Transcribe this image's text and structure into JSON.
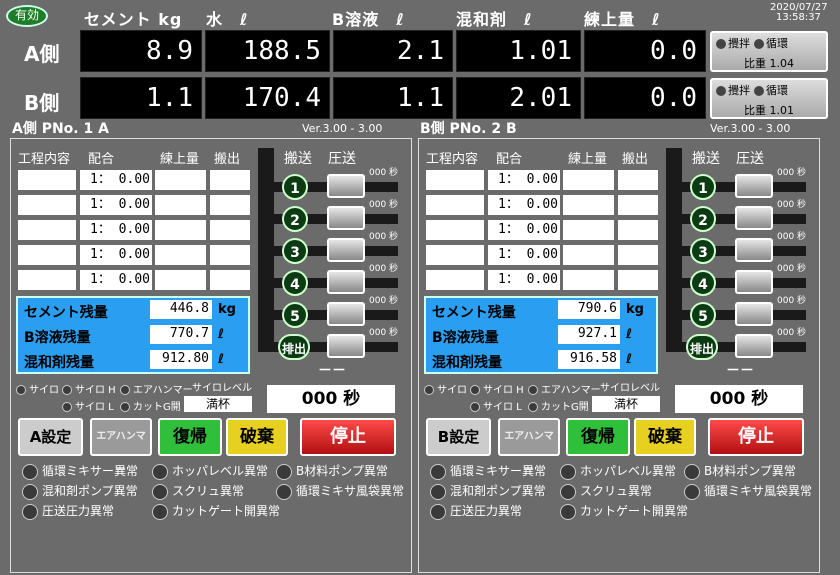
{
  "status_badge": "有効",
  "datetime": {
    "date": "2020/07/27",
    "time": "13:58:37"
  },
  "columns": {
    "cement": "セメント kg",
    "water": "水　ℓ",
    "bsol": "B溶液　ℓ",
    "mix": "混和剤　ℓ",
    "total": "練上量　ℓ"
  },
  "rows": [
    {
      "label": "A側",
      "cement": "8.9",
      "water": "188.5",
      "bsol": "2.1",
      "mix": "1.01",
      "total": "0.0",
      "stir": "攪拌",
      "cycle": "循環",
      "sg": "比重 1.04"
    },
    {
      "label": "B側",
      "cement": "1.1",
      "water": "170.4",
      "bsol": "1.1",
      "mix": "2.01",
      "total": "0.0",
      "stir": "攪拌",
      "cycle": "循環",
      "sg": "比重 1.01"
    }
  ],
  "panels": [
    {
      "title": "A側 PNo. 1 A",
      "version": "Ver.3.00 - 3.00",
      "head": {
        "process": "工程内容",
        "ratio": "配合",
        "total": "練上量",
        "out": "搬出",
        "convey": "搬送",
        "press": "圧送"
      },
      "ratios": [
        "1： 0.00",
        "1： 0.00",
        "1： 0.00",
        "1： 0.00",
        "1： 0.00"
      ],
      "sec": "000 秒",
      "nums": [
        "1",
        "2",
        "3",
        "4",
        "5"
      ],
      "discharge": "排出",
      "remain": [
        {
          "label": "セメント残量",
          "value": "446.8",
          "unit": "kg"
        },
        {
          "label": "B溶液残量",
          "value": "770.7",
          "unit": "ℓ"
        },
        {
          "label": "混和剤残量",
          "value": "912.80",
          "unit": "ℓ"
        }
      ],
      "dash": "－－",
      "silo": {
        "silo": "サイロ",
        "silo_h": "サイロ H",
        "silo_l": "サイロ L",
        "air": "エアハンマー",
        "cut": "カットG開",
        "level_label": "サイロレベル",
        "level": "満杯"
      },
      "timer": "000 秒",
      "buttons": {
        "set": "A設定",
        "air": "エアハンマー",
        "reset": "復帰",
        "discard": "破棄",
        "stop": "停止"
      },
      "alarms": [
        "循環ミキサー異常",
        "ホッパレベル異常",
        "B材料ポンプ異常",
        "混和剤ポンプ異常",
        "スクリュ異常",
        "循環ミキサ風袋異常",
        "圧送圧力異常",
        "カットゲート開異常"
      ]
    },
    {
      "title": "B側 PNo. 2 B",
      "version": "Ver.3.00 - 3.00",
      "head": {
        "process": "工程内容",
        "ratio": "配合",
        "total": "練上量",
        "out": "搬出",
        "convey": "搬送",
        "press": "圧送"
      },
      "ratios": [
        "1： 0.00",
        "1： 0.00",
        "1： 0.00",
        "1： 0.00",
        "1： 0.00"
      ],
      "sec": "000 秒",
      "nums": [
        "1",
        "2",
        "3",
        "4",
        "5"
      ],
      "discharge": "排出",
      "remain": [
        {
          "label": "セメント残量",
          "value": "790.6",
          "unit": "kg"
        },
        {
          "label": "B溶液残量",
          "value": "927.1",
          "unit": "ℓ"
        },
        {
          "label": "混和剤残量",
          "value": "916.58",
          "unit": "ℓ"
        }
      ],
      "dash": "－－",
      "silo": {
        "silo": "サイロ",
        "silo_h": "サイロ H",
        "silo_l": "サイロ L",
        "air": "エアハンマー",
        "cut": "カットG開",
        "level_label": "サイロレベル",
        "level": "満杯"
      },
      "timer": "000 秒",
      "buttons": {
        "set": "B設定",
        "air": "エアハンマー",
        "reset": "復帰",
        "discard": "破棄",
        "stop": "停止"
      },
      "alarms": [
        "循環ミキサー異常",
        "ホッパレベル異常",
        "B材料ポンプ異常",
        "混和剤ポンプ異常",
        "スクリュ異常",
        "循環ミキサ風袋異常",
        "圧送圧力異常",
        "カットゲート開異常"
      ]
    }
  ],
  "colors": {
    "background": "#6b6b6b",
    "value_box": "#000000",
    "residual_panel": "#2a9ef0",
    "reset_button": "#2fbf3a",
    "discard_button": "#e8d020",
    "stop_button": "#d42020",
    "badge": "#1f7d2a"
  }
}
